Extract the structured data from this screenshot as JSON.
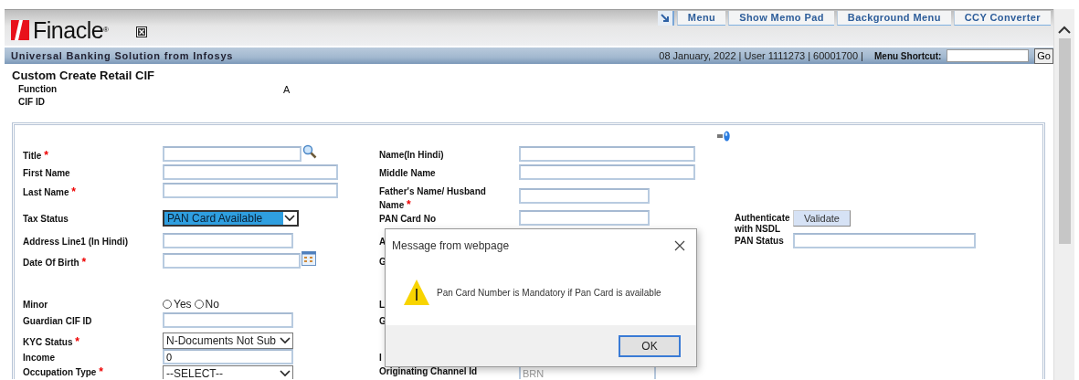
{
  "header": {
    "logo": "Finacle$^{®}$",
    "links": [
      {
        "label": "Menu"
      },
      {
        "label": "Show Memo Pad"
      },
      {
        "label": "Background Menu"
      },
      {
        "label": "CCY Converter"
      }
    ]
  },
  "banner": {
    "title": "Universal Banking Solution from Infosys",
    "info": "08 January, 2022 | User 1111273 | 60001700 |",
    "shortcut_label": "Menu Shortcut:",
    "go": "Go"
  },
  "page": {
    "title": "Custom Create Retail CIF",
    "summary": [
      {
        "label": "Function",
        "value": "A"
      },
      {
        "label": "CIF ID"
      }
    ]
  },
  "form": {
    "rows": [
      {
        "left": {
          "label": "Title",
          "required_mark": "*",
          "field": {
            "kind": "lookup"
          }
        },
        "middle": {
          "label": "Name(In Hindi)",
          "field": {
            "kind": "text"
          }
        }
      },
      {
        "left": {
          "label": "First Name",
          "field": {
            "kind": "text"
          }
        },
        "middle": {
          "label": "Middle Name",
          "field": {
            "kind": "text"
          }
        }
      },
      {
        "left": {
          "label": "Last Name",
          "required_mark": "*",
          "field": {
            "kind": "text"
          }
        },
        "middle": {
          "label": "Father's Name/ Husband Name",
          "required_mark": "*",
          "field": {
            "kind": "text"
          }
        }
      },
      {
        "left": {
          "label": "Tax Status",
          "field": {
            "kind": "select",
            "value": "PAN Card Available",
            "focused": true
          }
        },
        "middle": {
          "label": "PAN Card No",
          "field": {
            "kind": "text"
          }
        },
        "right": {
          "label": "Authenticate with NSDL",
          "field": {
            "kind": "button",
            "value": "Validate"
          }
        }
      },
      {
        "left": {
          "label": "Address Line1 (In Hindi)",
          "field": {
            "kind": "text"
          }
        },
        "middle": {
          "label": "A"
        },
        "right": {
          "label": "PAN Status",
          "field": {
            "kind": "text"
          }
        }
      },
      {
        "left": {
          "label": "Date Of Birth",
          "required_mark": "*",
          "field": {
            "kind": "date"
          }
        },
        "middle": {
          "label": "G"
        }
      },
      {},
      {
        "left": {
          "label": "Minor",
          "field": {
            "kind": "radio",
            "options": [
              {
                "label": "Yes",
                "selected": false
              },
              {
                "label": "No",
                "selected": false
              }
            ]
          }
        },
        "middle": {
          "label": "L"
        }
      },
      {
        "left": {
          "label": "Guardian CIF ID",
          "field": {
            "kind": "text"
          }
        },
        "middle": {
          "label": "G"
        }
      },
      {
        "left": {
          "label": "KYC Status",
          "required_mark": "*",
          "field": {
            "kind": "select",
            "value": "N-Documents Not Sub",
            "focused": false
          }
        }
      },
      {
        "left": {
          "label": "Income",
          "field": {
            "kind": "text",
            "value": "0"
          }
        },
        "middle": {
          "label": "I"
        }
      },
      {
        "left": {
          "label": "Occupation Type",
          "required_mark": "*",
          "field": {
            "kind": "select",
            "value": "--SELECT--",
            "focused": false
          }
        },
        "middle": {
          "label": "Originating Channel Id",
          "field": {
            "kind": "text",
            "value": "BRN",
            "disabled": true
          }
        }
      }
    ]
  },
  "dialog": {
    "title": "Message from webpage",
    "message": "Pan Card Number is Mandatory if Pan Card is available",
    "button": "OK"
  }
}
